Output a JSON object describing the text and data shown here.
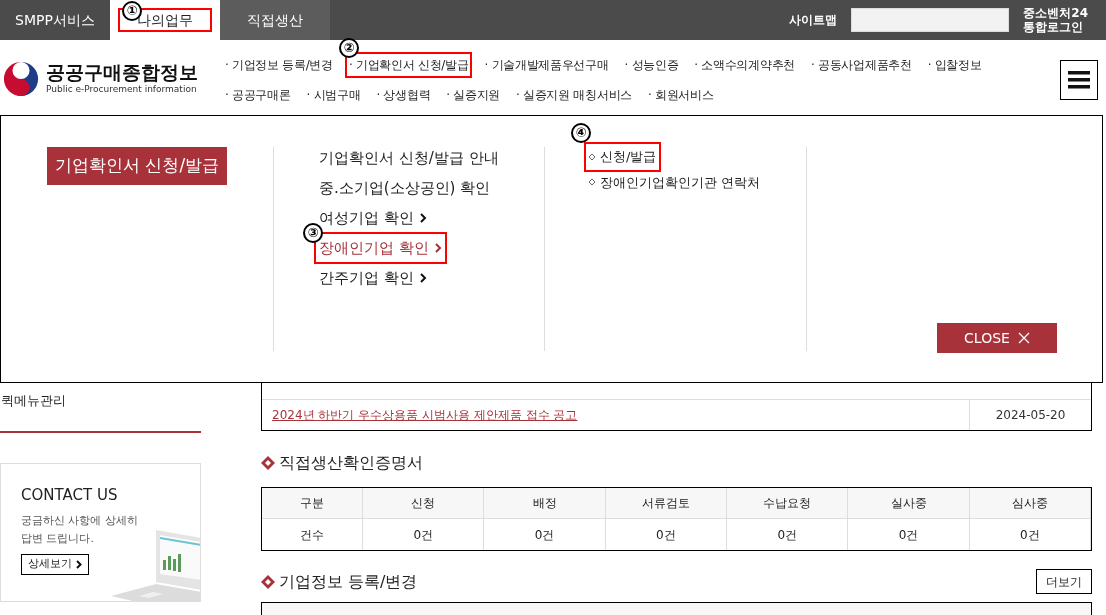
{
  "top_bar": {
    "tabs": [
      {
        "label": "SMPP서비스",
        "selected": false
      },
      {
        "label": "나의업무",
        "selected": true,
        "marker": "①"
      },
      {
        "label": "직접생산",
        "selected": false
      }
    ],
    "sitemap": "사이트맵",
    "login": [
      "중소벤처24",
      "통합로그인"
    ]
  },
  "logo": {
    "title": "공공구매종합정보",
    "subtitle": "Public e-Procurement information"
  },
  "nav": {
    "links": [
      {
        "label": "· 기업정보 등록/변경"
      },
      {
        "label": "· 기업확인서 신청/발급",
        "marker": "②"
      },
      {
        "label": "· 기술개발제품우선구매"
      },
      {
        "label": "· 성능인증"
      },
      {
        "label": "· 소액수의계약추천"
      },
      {
        "label": "· 공동사업제품추천"
      },
      {
        "label": "· 입찰정보"
      },
      {
        "label": "· 공공구매론"
      },
      {
        "label": "· 시범구매"
      },
      {
        "label": "· 상생협력"
      },
      {
        "label": "· 실증지원"
      },
      {
        "label": "· 실증지원 매칭서비스"
      },
      {
        "label": "· 회원서비스"
      }
    ]
  },
  "dropdown": {
    "title": "기업확인서 신청/발급",
    "items": [
      {
        "label": "기업확인서 신청/발급 안내",
        "has_arrow": false,
        "selected": false
      },
      {
        "label": "중.소기업(소상공인) 확인",
        "has_arrow": false,
        "selected": false
      },
      {
        "label": "여성기업 확인",
        "has_arrow": true,
        "selected": false
      },
      {
        "label": "장애인기업 확인",
        "has_arrow": true,
        "selected": true,
        "marker": "③"
      },
      {
        "label": "간주기업 확인",
        "has_arrow": true,
        "selected": false
      }
    ],
    "sub_items": [
      {
        "label": "신청/발급",
        "marker": "④"
      },
      {
        "label": "장애인기업확인기관 연락처"
      }
    ],
    "close": "CLOSE"
  },
  "sidebar": {
    "quick_menu": "퀵메뉴관리",
    "contact": {
      "title": "CONTACT US",
      "text": [
        "궁금하신 사항에 상세히",
        "답변 드립니다."
      ],
      "button": "상세보기"
    }
  },
  "notices": [
    {
      "title": "2024년 하반기 우수상용품 시범사용 제안제품 접수 공고",
      "date": "2024-05-20"
    }
  ],
  "certificates": {
    "heading": "직접생산확인증명서",
    "columns": [
      "구분",
      "신청",
      "배정",
      "서류검토",
      "수납요청",
      "실사중",
      "심사중"
    ],
    "row": [
      "건수",
      "0건",
      "0건",
      "0건",
      "0건",
      "0건",
      "0건"
    ]
  },
  "company_info": {
    "heading": "기업정보 등록/변경",
    "more": "더보기"
  }
}
